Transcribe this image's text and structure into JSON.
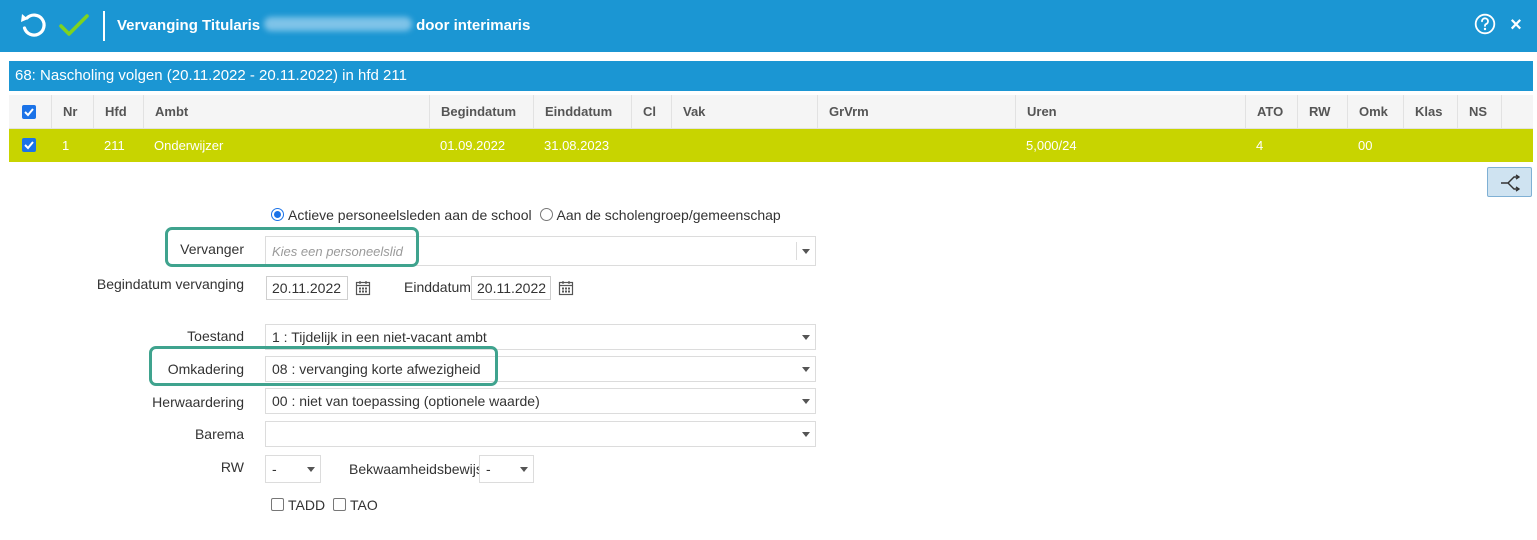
{
  "titlebar": {
    "title_prefix": "Vervanging Titularis",
    "title_suffix": "door interimaris",
    "close_glyph": "×"
  },
  "icons": {
    "undo": "undo-icon",
    "confirm": "checkmark-icon",
    "help": "help-circle-icon",
    "close": "close-icon",
    "split": "split-arrows-icon",
    "calendar": "calendar-icon",
    "dropdown": "chevron-down-icon"
  },
  "section": {
    "title": "68: Nascholing volgen (20.11.2022 - 20.11.2022) in hfd 211"
  },
  "table": {
    "columns": [
      "Nr",
      "Hfd",
      "Ambt",
      "Begindatum",
      "Einddatum",
      "Cl",
      "Vak",
      "GrVrm",
      "Uren",
      "ATO",
      "RW",
      "Omk",
      "Klas",
      "NS"
    ],
    "rows": [
      {
        "checked": true,
        "nr": "1",
        "hfd": "211",
        "ambt": "Onderwijzer",
        "begindatum": "01.09.2022",
        "einddatum": "31.08.2023",
        "cl": "",
        "vak": "",
        "grvrm": "",
        "uren": "5,000/24",
        "ato": "4",
        "rw": "",
        "omk": "00",
        "klas": "",
        "ns": ""
      }
    ]
  },
  "form": {
    "radio_active": "Actieve personeelsleden aan de school",
    "radio_group": "Aan de scholengroep/gemeenschap",
    "vervanger_label": "Vervanger",
    "vervanger_placeholder": "Kies een personeelslid",
    "begindatum_label": "Begindatum vervanging",
    "begindatum_value": "20.11.2022",
    "einddatum_label": "Einddatum",
    "einddatum_value": "20.11.2022",
    "toestand_label": "Toestand",
    "toestand_value": "1 : Tijdelijk in een niet-vacant ambt",
    "omkadering_label": "Omkadering",
    "omkadering_value": "08 : vervanging korte afwezigheid",
    "herwaardering_label": "Herwaardering",
    "herwaardering_value": "00 : niet van toepassing (optionele waarde)",
    "barema_label": "Barema",
    "barema_value": "",
    "rw_label": "RW",
    "rw_value": "-",
    "bekwaam_label": "Bekwaamheidsbewijs",
    "bekwaam_value": "-",
    "tadd_label": "TADD",
    "tao_label": "TAO"
  },
  "colors": {
    "header_blue": "#1b96d3",
    "selected_row": "#c8d400",
    "highlight": "#3fa38e",
    "check_green": "#7ed321"
  }
}
